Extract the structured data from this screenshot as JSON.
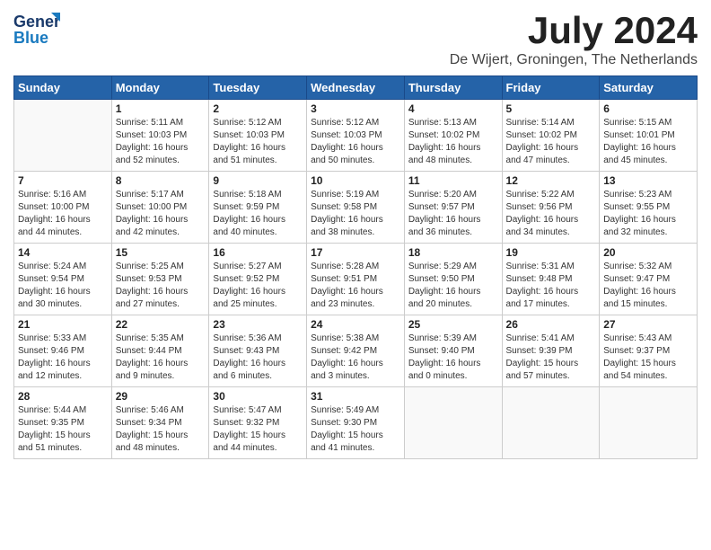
{
  "header": {
    "logo_line1": "General",
    "logo_line2": "Blue",
    "month": "July 2024",
    "location": "De Wijert, Groningen, The Netherlands"
  },
  "weekdays": [
    "Sunday",
    "Monday",
    "Tuesday",
    "Wednesday",
    "Thursday",
    "Friday",
    "Saturday"
  ],
  "weeks": [
    [
      {
        "day": "",
        "info": ""
      },
      {
        "day": "1",
        "info": "Sunrise: 5:11 AM\nSunset: 10:03 PM\nDaylight: 16 hours\nand 52 minutes."
      },
      {
        "day": "2",
        "info": "Sunrise: 5:12 AM\nSunset: 10:03 PM\nDaylight: 16 hours\nand 51 minutes."
      },
      {
        "day": "3",
        "info": "Sunrise: 5:12 AM\nSunset: 10:03 PM\nDaylight: 16 hours\nand 50 minutes."
      },
      {
        "day": "4",
        "info": "Sunrise: 5:13 AM\nSunset: 10:02 PM\nDaylight: 16 hours\nand 48 minutes."
      },
      {
        "day": "5",
        "info": "Sunrise: 5:14 AM\nSunset: 10:02 PM\nDaylight: 16 hours\nand 47 minutes."
      },
      {
        "day": "6",
        "info": "Sunrise: 5:15 AM\nSunset: 10:01 PM\nDaylight: 16 hours\nand 45 minutes."
      }
    ],
    [
      {
        "day": "7",
        "info": "Sunrise: 5:16 AM\nSunset: 10:00 PM\nDaylight: 16 hours\nand 44 minutes."
      },
      {
        "day": "8",
        "info": "Sunrise: 5:17 AM\nSunset: 10:00 PM\nDaylight: 16 hours\nand 42 minutes."
      },
      {
        "day": "9",
        "info": "Sunrise: 5:18 AM\nSunset: 9:59 PM\nDaylight: 16 hours\nand 40 minutes."
      },
      {
        "day": "10",
        "info": "Sunrise: 5:19 AM\nSunset: 9:58 PM\nDaylight: 16 hours\nand 38 minutes."
      },
      {
        "day": "11",
        "info": "Sunrise: 5:20 AM\nSunset: 9:57 PM\nDaylight: 16 hours\nand 36 minutes."
      },
      {
        "day": "12",
        "info": "Sunrise: 5:22 AM\nSunset: 9:56 PM\nDaylight: 16 hours\nand 34 minutes."
      },
      {
        "day": "13",
        "info": "Sunrise: 5:23 AM\nSunset: 9:55 PM\nDaylight: 16 hours\nand 32 minutes."
      }
    ],
    [
      {
        "day": "14",
        "info": "Sunrise: 5:24 AM\nSunset: 9:54 PM\nDaylight: 16 hours\nand 30 minutes."
      },
      {
        "day": "15",
        "info": "Sunrise: 5:25 AM\nSunset: 9:53 PM\nDaylight: 16 hours\nand 27 minutes."
      },
      {
        "day": "16",
        "info": "Sunrise: 5:27 AM\nSunset: 9:52 PM\nDaylight: 16 hours\nand 25 minutes."
      },
      {
        "day": "17",
        "info": "Sunrise: 5:28 AM\nSunset: 9:51 PM\nDaylight: 16 hours\nand 23 minutes."
      },
      {
        "day": "18",
        "info": "Sunrise: 5:29 AM\nSunset: 9:50 PM\nDaylight: 16 hours\nand 20 minutes."
      },
      {
        "day": "19",
        "info": "Sunrise: 5:31 AM\nSunset: 9:48 PM\nDaylight: 16 hours\nand 17 minutes."
      },
      {
        "day": "20",
        "info": "Sunrise: 5:32 AM\nSunset: 9:47 PM\nDaylight: 16 hours\nand 15 minutes."
      }
    ],
    [
      {
        "day": "21",
        "info": "Sunrise: 5:33 AM\nSunset: 9:46 PM\nDaylight: 16 hours\nand 12 minutes."
      },
      {
        "day": "22",
        "info": "Sunrise: 5:35 AM\nSunset: 9:44 PM\nDaylight: 16 hours\nand 9 minutes."
      },
      {
        "day": "23",
        "info": "Sunrise: 5:36 AM\nSunset: 9:43 PM\nDaylight: 16 hours\nand 6 minutes."
      },
      {
        "day": "24",
        "info": "Sunrise: 5:38 AM\nSunset: 9:42 PM\nDaylight: 16 hours\nand 3 minutes."
      },
      {
        "day": "25",
        "info": "Sunrise: 5:39 AM\nSunset: 9:40 PM\nDaylight: 16 hours\nand 0 minutes."
      },
      {
        "day": "26",
        "info": "Sunrise: 5:41 AM\nSunset: 9:39 PM\nDaylight: 15 hours\nand 57 minutes."
      },
      {
        "day": "27",
        "info": "Sunrise: 5:43 AM\nSunset: 9:37 PM\nDaylight: 15 hours\nand 54 minutes."
      }
    ],
    [
      {
        "day": "28",
        "info": "Sunrise: 5:44 AM\nSunset: 9:35 PM\nDaylight: 15 hours\nand 51 minutes."
      },
      {
        "day": "29",
        "info": "Sunrise: 5:46 AM\nSunset: 9:34 PM\nDaylight: 15 hours\nand 48 minutes."
      },
      {
        "day": "30",
        "info": "Sunrise: 5:47 AM\nSunset: 9:32 PM\nDaylight: 15 hours\nand 44 minutes."
      },
      {
        "day": "31",
        "info": "Sunrise: 5:49 AM\nSunset: 9:30 PM\nDaylight: 15 hours\nand 41 minutes."
      },
      {
        "day": "",
        "info": ""
      },
      {
        "day": "",
        "info": ""
      },
      {
        "day": "",
        "info": ""
      }
    ]
  ]
}
